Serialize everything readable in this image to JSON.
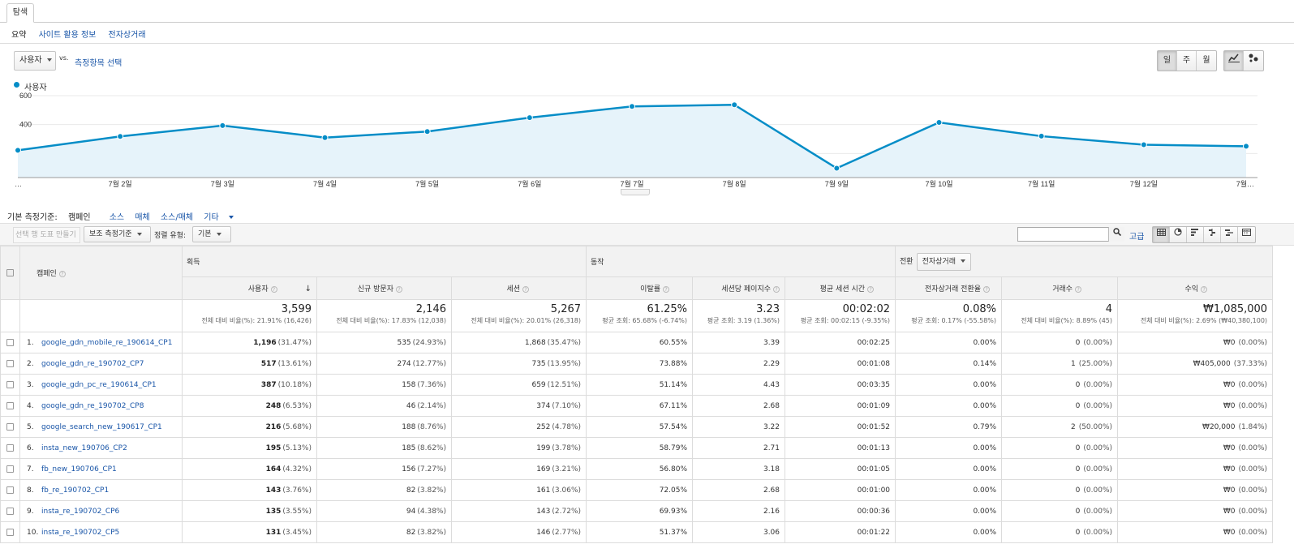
{
  "tabs": {
    "explore": "탐색"
  },
  "subtabs": {
    "summary": "요약",
    "site_usage": "사이트 활용 정보",
    "ecommerce": "전자상거래"
  },
  "metric_selector": {
    "value": "사용자",
    "vs": "vs.",
    "choose": "측정항목 선택"
  },
  "period_buttons": {
    "day": "일",
    "week": "주",
    "month": "월",
    "selected": "day"
  },
  "chart_type_icons": [
    "line-chart-icon",
    "motion-chart-icon"
  ],
  "chart_data": {
    "type": "area",
    "legend": "사용자",
    "color": "#058dc7",
    "x": [
      "…",
      "7월 2일",
      "7월 3일",
      "7월 4일",
      "7월 5일",
      "7월 6일",
      "7월 7일",
      "7월 8일",
      "7월 9일",
      "7월 10일",
      "7월 11일",
      "7월 12일",
      "7월…"
    ],
    "values": [
      222,
      318,
      393,
      310,
      352,
      448,
      526,
      537,
      98,
      415,
      320,
      261,
      250
    ],
    "y_ticks": [
      200,
      400,
      600
    ],
    "ylim": [
      0,
      600
    ],
    "grid": true
  },
  "dimension_bar": {
    "label": "기본 측정기준:",
    "current": "캠페인",
    "options": [
      "소스",
      "매체",
      "소스/매체"
    ],
    "other": "기타"
  },
  "toolbar": {
    "plot_rows": "선택 행 도표 만들기",
    "secondary_dim": "보조 측정기준",
    "sort_label": "정렬 유형:",
    "sort_value": "기본",
    "search_placeholder": "",
    "advanced": "고급"
  },
  "table": {
    "dimension_header": "캠페인",
    "groups": {
      "acquisition": "획득",
      "behavior": "동작",
      "conversion": "전환",
      "conversion_select": "전자상거래"
    },
    "columns": [
      "사용자",
      "신규 방문자",
      "세션",
      "이탈률",
      "세션당 페이지수",
      "평균 세션 시간",
      "전자상거래 전환율",
      "거래수",
      "수익"
    ],
    "totals": [
      {
        "value": "3,599",
        "sub": "전체 대비 비율(%): 21.91% (16,426)"
      },
      {
        "value": "2,146",
        "sub": "전체 대비 비율(%): 17.83% (12,038)"
      },
      {
        "value": "5,267",
        "sub": "전체 대비 비율(%): 20.01% (26,318)"
      },
      {
        "value": "61.25%",
        "sub": "평균 조회: 65.68% (-6.74%)"
      },
      {
        "value": "3.23",
        "sub": "평균 조회: 3.19 (1.36%)"
      },
      {
        "value": "00:02:02",
        "sub": "평균 조회: 00:02:15 (-9.35%)"
      },
      {
        "value": "0.08%",
        "sub": "평균 조회: 0.17% (-55.58%)"
      },
      {
        "value": "4",
        "sub": "전체 대비 비율(%): 8.89% (45)"
      },
      {
        "value": "₩1,085,000",
        "sub": "전체 대비 비율(%): 2.69% (₩40,380,100)"
      }
    ],
    "rows": [
      {
        "idx": "1.",
        "campaign": "google_gdn_mobile_re_190614_CP1",
        "users": "1,196",
        "users_pct": "(31.47%)",
        "new": "535",
        "new_pct": "(24.93%)",
        "sessions": "1,868",
        "sessions_pct": "(35.47%)",
        "bounce": "60.55%",
        "pps": "3.39",
        "dur": "00:02:25",
        "conv": "0.00%",
        "tx": "0",
        "tx_pct": "(0.00%)",
        "rev": "₩0",
        "rev_pct": "(0.00%)"
      },
      {
        "idx": "2.",
        "campaign": "google_gdn_re_190702_CP7",
        "users": "517",
        "users_pct": "(13.61%)",
        "new": "274",
        "new_pct": "(12.77%)",
        "sessions": "735",
        "sessions_pct": "(13.95%)",
        "bounce": "73.88%",
        "pps": "2.29",
        "dur": "00:01:08",
        "conv": "0.14%",
        "tx": "1",
        "tx_pct": "(25.00%)",
        "rev": "₩405,000",
        "rev_pct": "(37.33%)"
      },
      {
        "idx": "3.",
        "campaign": "google_gdn_pc_re_190614_CP1",
        "users": "387",
        "users_pct": "(10.18%)",
        "new": "158",
        "new_pct": "(7.36%)",
        "sessions": "659",
        "sessions_pct": "(12.51%)",
        "bounce": "51.14%",
        "pps": "4.43",
        "dur": "00:03:35",
        "conv": "0.00%",
        "tx": "0",
        "tx_pct": "(0.00%)",
        "rev": "₩0",
        "rev_pct": "(0.00%)"
      },
      {
        "idx": "4.",
        "campaign": "google_gdn_re_190702_CP8",
        "users": "248",
        "users_pct": "(6.53%)",
        "new": "46",
        "new_pct": "(2.14%)",
        "sessions": "374",
        "sessions_pct": "(7.10%)",
        "bounce": "67.11%",
        "pps": "2.68",
        "dur": "00:01:09",
        "conv": "0.00%",
        "tx": "0",
        "tx_pct": "(0.00%)",
        "rev": "₩0",
        "rev_pct": "(0.00%)"
      },
      {
        "idx": "5.",
        "campaign": "google_search_new_190617_CP1",
        "users": "216",
        "users_pct": "(5.68%)",
        "new": "188",
        "new_pct": "(8.76%)",
        "sessions": "252",
        "sessions_pct": "(4.78%)",
        "bounce": "57.54%",
        "pps": "3.22",
        "dur": "00:01:52",
        "conv": "0.79%",
        "tx": "2",
        "tx_pct": "(50.00%)",
        "rev": "₩20,000",
        "rev_pct": "(1.84%)"
      },
      {
        "idx": "6.",
        "campaign": "insta_new_190706_CP2",
        "users": "195",
        "users_pct": "(5.13%)",
        "new": "185",
        "new_pct": "(8.62%)",
        "sessions": "199",
        "sessions_pct": "(3.78%)",
        "bounce": "58.79%",
        "pps": "2.71",
        "dur": "00:01:13",
        "conv": "0.00%",
        "tx": "0",
        "tx_pct": "(0.00%)",
        "rev": "₩0",
        "rev_pct": "(0.00%)"
      },
      {
        "idx": "7.",
        "campaign": "fb_new_190706_CP1",
        "users": "164",
        "users_pct": "(4.32%)",
        "new": "156",
        "new_pct": "(7.27%)",
        "sessions": "169",
        "sessions_pct": "(3.21%)",
        "bounce": "56.80%",
        "pps": "3.18",
        "dur": "00:01:05",
        "conv": "0.00%",
        "tx": "0",
        "tx_pct": "(0.00%)",
        "rev": "₩0",
        "rev_pct": "(0.00%)"
      },
      {
        "idx": "8.",
        "campaign": "fb_re_190702_CP1",
        "users": "143",
        "users_pct": "(3.76%)",
        "new": "82",
        "new_pct": "(3.82%)",
        "sessions": "161",
        "sessions_pct": "(3.06%)",
        "bounce": "72.05%",
        "pps": "2.68",
        "dur": "00:01:00",
        "conv": "0.00%",
        "tx": "0",
        "tx_pct": "(0.00%)",
        "rev": "₩0",
        "rev_pct": "(0.00%)"
      },
      {
        "idx": "9.",
        "campaign": "insta_re_190702_CP6",
        "users": "135",
        "users_pct": "(3.55%)",
        "new": "94",
        "new_pct": "(4.38%)",
        "sessions": "143",
        "sessions_pct": "(2.72%)",
        "bounce": "69.93%",
        "pps": "2.16",
        "dur": "00:00:36",
        "conv": "0.00%",
        "tx": "0",
        "tx_pct": "(0.00%)",
        "rev": "₩0",
        "rev_pct": "(0.00%)"
      },
      {
        "idx": "10.",
        "campaign": "insta_re_190702_CP5",
        "users": "131",
        "users_pct": "(3.45%)",
        "new": "82",
        "new_pct": "(3.82%)",
        "sessions": "146",
        "sessions_pct": "(2.77%)",
        "bounce": "51.37%",
        "pps": "3.06",
        "dur": "00:01:22",
        "conv": "0.00%",
        "tx": "0",
        "tx_pct": "(0.00%)",
        "rev": "₩0",
        "rev_pct": "(0.00%)"
      }
    ]
  }
}
